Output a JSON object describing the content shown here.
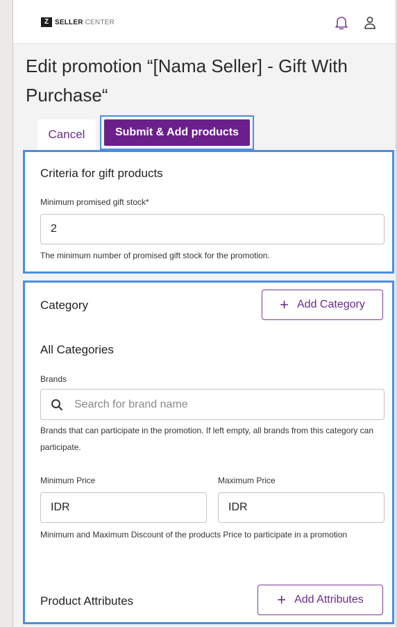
{
  "header": {
    "logo_mark": "Z",
    "logo_bold": "SELLER",
    "logo_light": "CENTER",
    "icons": [
      "bell-icon",
      "user-icon"
    ]
  },
  "page": {
    "title": "Edit promotion “[Nama Seller] - Gift With Purchase“"
  },
  "actions": {
    "cancel_label": "Cancel",
    "submit_label": "Submit & Add products"
  },
  "criteria": {
    "title": "Criteria for gift products",
    "min_stock_label": "Minimum promised gift stock*",
    "min_stock_value": "2",
    "min_stock_help": "The minimum number of promised gift stock for the promotion."
  },
  "category": {
    "title": "Category",
    "add_button_label": "Add Category",
    "selected": "All Categories",
    "brands_label": "Brands",
    "brands_placeholder": "Search for brand name",
    "brands_help": "Brands that can participate in the promotion. If left empty, all brands from this category can participate.",
    "min_price_label": "Minimum Price",
    "max_price_label": "Maximum Price",
    "min_price_value": "IDR",
    "max_price_value": "IDR",
    "price_help": "Minimum and Maximum Discount of the products Price to participate in a promotion",
    "attributes_title": "Product Attributes",
    "add_attributes_label": "Add Attributes"
  },
  "colors": {
    "accent": "#6b1f8a",
    "highlight": "#4a8fe0",
    "background": "#f3f3f3"
  }
}
